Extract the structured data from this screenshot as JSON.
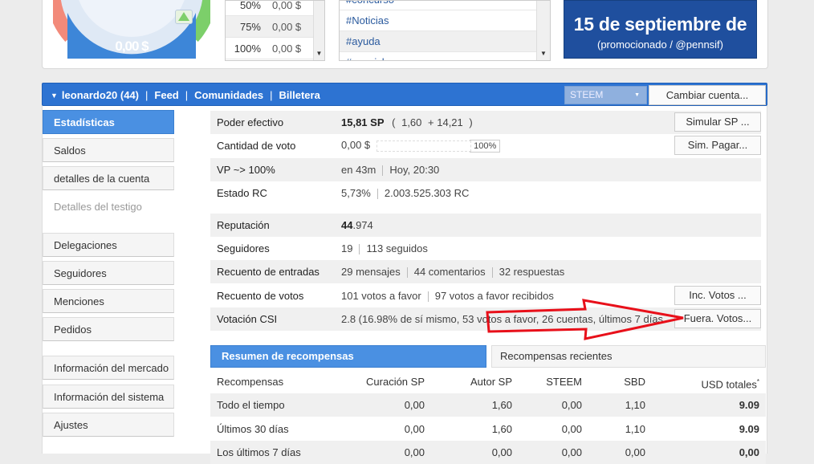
{
  "gauge": {
    "value": "0,00 $"
  },
  "vote_percent_table": [
    {
      "pct": "50%",
      "value": "0,00 $"
    },
    {
      "pct": "75%",
      "value": "0,00 $"
    },
    {
      "pct": "100%",
      "value": "0,00 $"
    }
  ],
  "tags": [
    "#concurso",
    "#Noticias",
    "#ayuda",
    "#spanish"
  ],
  "promo": {
    "title": "15 de septiembre de",
    "subtitle": "(promocionado / @pennsif)"
  },
  "navbar": {
    "user": "leonardo20 (44)",
    "links": [
      "Feed",
      "Comunidades",
      "Billetera"
    ],
    "coin": "STEEM",
    "switch_account": "Cambiar cuenta..."
  },
  "sidebar": {
    "items": [
      {
        "label": "Estadísticas"
      },
      {
        "label": "Saldos"
      },
      {
        "label": "detalles de la cuenta"
      },
      {
        "label": "Detalles del testigo"
      },
      {
        "label": "Delegaciones"
      },
      {
        "label": "Seguidores"
      },
      {
        "label": "Menciones"
      },
      {
        "label": "Pedidos"
      },
      {
        "label": "Información del mercado"
      },
      {
        "label": "Información del sistema"
      },
      {
        "label": "Ajustes"
      }
    ]
  },
  "stats": {
    "effective_power": {
      "label": "Poder efectivo",
      "sp": "15,81 SP",
      "detail_open": "(",
      "own": "1,60",
      "delegated": "+ 14,21",
      "detail_close": ")",
      "button": "Simular SP ..."
    },
    "vote_amount": {
      "label": "Cantidad de voto",
      "value": "0,00 $",
      "pct": "100%",
      "button": "Sim. Pagar..."
    },
    "vp": {
      "label": "VP ~> 100%",
      "time": "en 43m",
      "when": "Hoy, 20:30"
    },
    "rc": {
      "label": "Estado RC",
      "pct": "5,73%",
      "value": "2.003.525.303 RC"
    },
    "reputation": {
      "label": "Reputación",
      "main": "44",
      "decimals": ".974"
    },
    "followers": {
      "label": "Seguidores",
      "count": "19",
      "following": "113 seguidos"
    },
    "posts": {
      "label": "Recuento de entradas",
      "posts": "29 mensajes",
      "comments": "44 comentarios",
      "replies": "32 respuestas"
    },
    "votes": {
      "label": "Recuento de votos",
      "given": "101 votos a favor",
      "received": "97 votos a favor recibidos",
      "button": "Inc. Votos ..."
    },
    "csi": {
      "label": "Votación CSI",
      "value": "2.8 (16.98% de sí mismo, 53 votos a favor, 26 cuentas, últimos 7 días",
      "button": "Fuera. Votos..."
    }
  },
  "rewards": {
    "tab_active": "Resumen de recompensas",
    "tab_other": "Recompensas recientes",
    "headers": [
      "Recompensas",
      "Curación SP",
      "Autor SP",
      "STEEM",
      "SBD",
      "USD totales"
    ],
    "header_mark": "*",
    "rows": [
      [
        "Todo el tiempo",
        "0,00",
        "1,60",
        "0,00",
        "1,10",
        "9.09"
      ],
      [
        "Últimos 30 días",
        "0,00",
        "1,60",
        "0,00",
        "1,10",
        "9.09"
      ],
      [
        "Los últimos 7 días",
        "0,00",
        "0,00",
        "0,00",
        "0,00",
        "0,00"
      ]
    ]
  },
  "colors": {
    "accent": "#4a90e2",
    "navbar": "#2d73d2",
    "promo": "#1f4f9e",
    "annotation": "#e8101a"
  }
}
